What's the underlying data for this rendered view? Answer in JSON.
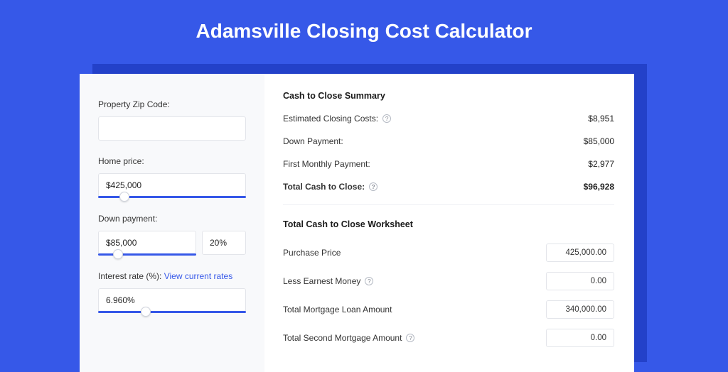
{
  "header": {
    "title": "Adamsville Closing Cost Calculator"
  },
  "sidebar": {
    "zip": {
      "label": "Property Zip Code:",
      "value": ""
    },
    "home_price": {
      "label": "Home price:",
      "value": "$425,000",
      "slider_pct": 18
    },
    "down_payment": {
      "label": "Down payment:",
      "value": "$85,000",
      "pct_value": "20%",
      "slider_pct": 20
    },
    "interest_rate": {
      "label": "Interest rate (%):",
      "link_text": "View current rates",
      "value": "6.960%",
      "slider_pct": 32
    }
  },
  "summary": {
    "heading": "Cash to Close Summary",
    "rows": [
      {
        "label": "Estimated Closing Costs:",
        "help": true,
        "value": "$8,951"
      },
      {
        "label": "Down Payment:",
        "help": false,
        "value": "$85,000"
      },
      {
        "label": "First Monthly Payment:",
        "help": false,
        "value": "$2,977"
      }
    ],
    "total": {
      "label": "Total Cash to Close:",
      "help": true,
      "value": "$96,928"
    }
  },
  "worksheet": {
    "heading": "Total Cash to Close Worksheet",
    "rows": [
      {
        "label": "Purchase Price",
        "help": false,
        "value": "425,000.00"
      },
      {
        "label": "Less Earnest Money",
        "help": true,
        "value": "0.00"
      },
      {
        "label": "Total Mortgage Loan Amount",
        "help": false,
        "value": "340,000.00"
      },
      {
        "label": "Total Second Mortgage Amount",
        "help": true,
        "value": "0.00"
      }
    ]
  }
}
